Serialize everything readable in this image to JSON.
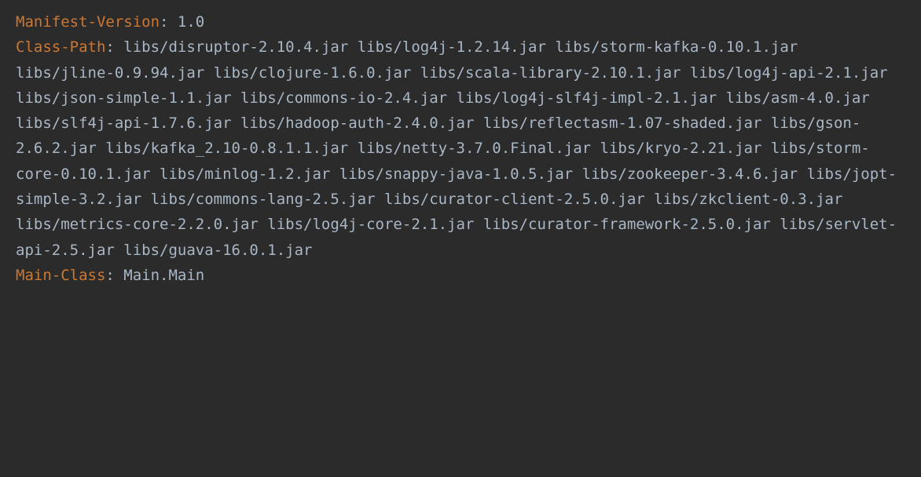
{
  "manifest": {
    "entries": [
      {
        "key": "Manifest-Version",
        "value": "1.0"
      },
      {
        "key": "Class-Path",
        "value": "libs/disruptor-2.10.4.jar libs/log4j-1.2.14.jar libs/storm-kafka-0.10.1.jar libs/jline-0.9.94.jar libs/clojure-1.6.0.jar libs/scala-library-2.10.1.jar libs/log4j-api-2.1.jar libs/json-simple-1.1.jar libs/commons-io-2.4.jar libs/log4j-slf4j-impl-2.1.jar libs/asm-4.0.jar libs/slf4j-api-1.7.6.jar libs/hadoop-auth-2.4.0.jar libs/reflectasm-1.07-shaded.jar libs/gson-2.6.2.jar libs/kafka_2.10-0.8.1.1.jar libs/netty-3.7.0.Final.jar libs/kryo-2.21.jar libs/storm-core-0.10.1.jar libs/minlog-1.2.jar libs/snappy-java-1.0.5.jar libs/zookeeper-3.4.6.jar libs/jopt-simple-3.2.jar libs/commons-lang-2.5.jar libs/curator-client-2.5.0.jar libs/zkclient-0.3.jar libs/metrics-core-2.2.0.jar libs/log4j-core-2.1.jar libs/curator-framework-2.5.0.jar libs/servlet-api-2.5.jar libs/guava-16.0.1.jar"
      },
      {
        "key": "Main-Class",
        "value": "Main.Main"
      }
    ]
  }
}
